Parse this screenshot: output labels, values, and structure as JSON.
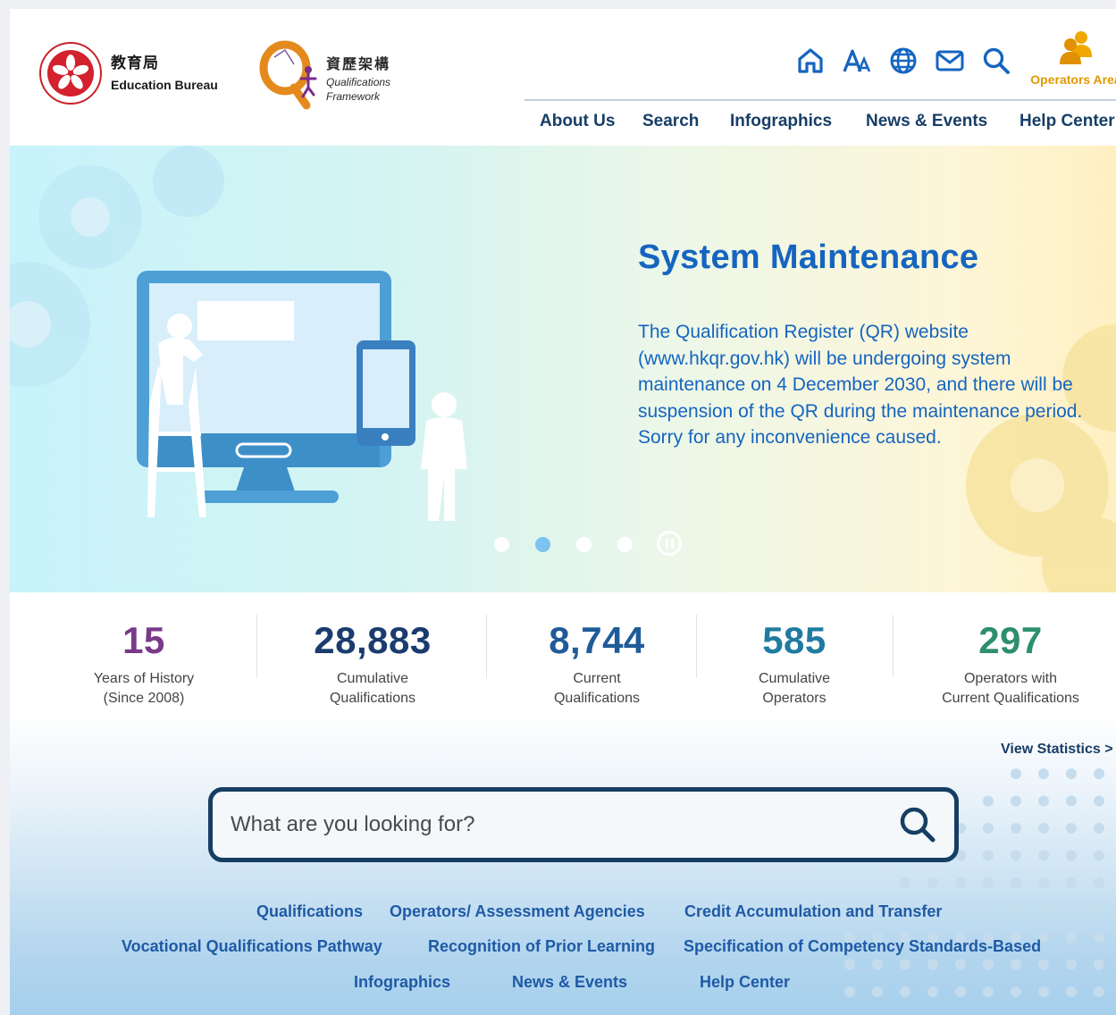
{
  "header": {
    "edb": {
      "zh": "教育局",
      "en": "Education Bureau"
    },
    "qf": {
      "zh": "資歷架構",
      "en_line1": "Qualifications",
      "en_line2": "Framework"
    },
    "operators_area": "Operators Area",
    "nav": [
      "About Us",
      "Search",
      "Infographics",
      "News & Events",
      "Help Center"
    ]
  },
  "hero": {
    "title": "System Maintenance",
    "body": "The Qualification Register (QR) website (www.hkqr.gov.hk) will be undergoing system maintenance on 4 December 2030, and there will be suspension of the QR during the maintenance period. Sorry for any inconvenience caused.",
    "slides": 4,
    "active_slide": 2
  },
  "stats": [
    {
      "value": "15",
      "line1": "Years of History",
      "line2": "(Since 2008)",
      "color": "#7a3a8a"
    },
    {
      "value": "28,883",
      "line1": "Cumulative",
      "line2": "Qualifications",
      "color": "#1a3c6e"
    },
    {
      "value": "8,744",
      "line1": "Current",
      "line2": "Qualifications",
      "color": "#1f5b99"
    },
    {
      "value": "585",
      "line1": "Cumulative",
      "line2": "Operators",
      "color": "#1f7ba0"
    },
    {
      "value": "297",
      "line1": "Operators with",
      "line2": "Current Qualifications",
      "color": "#2e8f6c"
    }
  ],
  "view_statistics": "View Statistics >",
  "search": {
    "placeholder": "What are you looking for?"
  },
  "quick_links": {
    "row1": [
      "Qualifications",
      "Operators/ Assessment Agencies",
      "Credit Accumulation and Transfer"
    ],
    "row2": [
      "Vocational Qualifications Pathway",
      "Recognition of Prior Learning",
      "Specification of Competency Standards-Based"
    ],
    "row3": [
      "Infographics",
      "News & Events",
      "Help Center"
    ]
  },
  "icons": [
    "home-icon",
    "font-size-icon",
    "globe-icon",
    "mail-icon",
    "search-icon",
    "operators-icon"
  ],
  "colors": {
    "navy": "#173e66",
    "hero_blue": "#1565c0",
    "link_blue": "#1f5aa6",
    "orange": "#e09a00"
  }
}
